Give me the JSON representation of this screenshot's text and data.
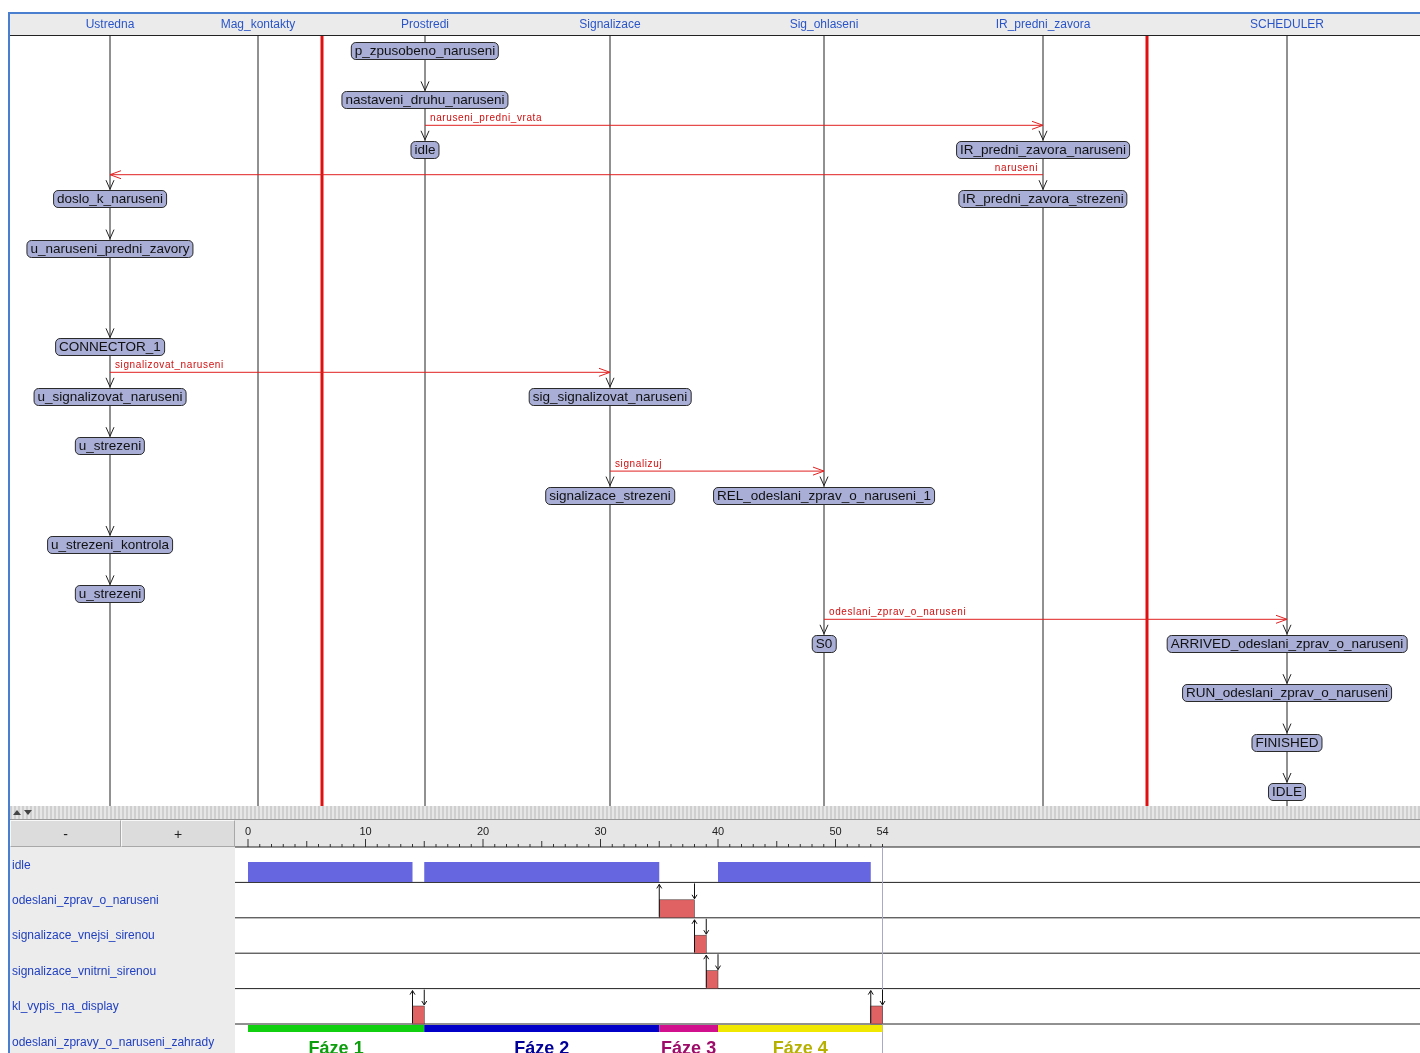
{
  "lanes": [
    {
      "name": "Ustredna",
      "boundary_before": false
    },
    {
      "name": "Mag_kontakty",
      "boundary_before": false
    },
    {
      "name": "Prostredi",
      "boundary_before": true
    },
    {
      "name": "Signalizace",
      "boundary_before": false
    },
    {
      "name": "Sig_ohlaseni",
      "boundary_before": false
    },
    {
      "name": "IR_predni_zavora",
      "boundary_before": false
    },
    {
      "name": "SCHEDULER",
      "boundary_before": true
    }
  ],
  "rows": [
    {
      "cells": [
        null,
        null,
        {
          "label": "p_zpusobeno_naruseni"
        },
        null,
        null,
        null,
        null
      ]
    },
    {
      "cells": [
        null,
        null,
        {
          "label": "nastaveni_druhu_naruseni"
        },
        null,
        null,
        null,
        null
      ]
    },
    {
      "cells": [
        null,
        null,
        {
          "label": "idle",
          "message_source": true
        },
        null,
        null,
        {
          "label": "IR_predni_zavora_naruseni",
          "message_target": true
        },
        null
      ],
      "message": {
        "label": "naruseni_predni_vrata"
      }
    },
    {
      "cells": [
        {
          "label": "doslo_k_naruseni",
          "message_target": true
        },
        null,
        null,
        null,
        null,
        {
          "label": "IR_predni_zavora_strezeni",
          "message_source": true
        },
        null
      ],
      "message": {
        "label": "naruseni"
      }
    },
    {
      "cells": [
        {
          "label": "u_naruseni_predni_zavory"
        },
        null,
        null,
        null,
        null,
        null,
        null
      ]
    },
    {
      "cells": [
        null,
        null,
        null,
        null,
        null,
        null,
        null
      ]
    },
    {
      "cells": [
        {
          "label": "CONNECTOR_1"
        },
        null,
        null,
        null,
        null,
        null,
        null
      ]
    },
    {
      "cells": [
        {
          "label": "u_signalizovat_naruseni",
          "message_source": true
        },
        null,
        null,
        {
          "label": "sig_signalizovat_naruseni",
          "message_target": true
        },
        null,
        null,
        null
      ],
      "message": {
        "label": "signalizovat_naruseni"
      }
    },
    {
      "cells": [
        {
          "label": "u_strezeni"
        },
        null,
        null,
        null,
        null,
        null,
        null
      ]
    },
    {
      "cells": [
        null,
        null,
        null,
        {
          "label": "signalizace_strezeni",
          "message_source": true
        },
        {
          "label": "REL_odeslani_zprav_o_naruseni_1",
          "message_target": true
        },
        null,
        null
      ],
      "message": {
        "label": "signalizuj"
      }
    },
    {
      "cells": [
        {
          "label": "u_strezeni_kontrola"
        },
        null,
        null,
        null,
        null,
        null,
        null
      ]
    },
    {
      "cells": [
        {
          "label": "u_strezeni"
        },
        null,
        null,
        null,
        null,
        null,
        null
      ]
    },
    {
      "cells": [
        null,
        null,
        null,
        null,
        {
          "label": "S0",
          "message_source": true
        },
        null,
        {
          "label": "ARRIVED_odeslani_zprav_o_naruseni",
          "message_target": true
        }
      ],
      "message": {
        "label": "odeslani_zprav_o_naruseni"
      }
    },
    {
      "cells": [
        null,
        null,
        null,
        null,
        null,
        null,
        {
          "label": "RUN_odeslani_zprav_o_naruseni"
        }
      ]
    },
    {
      "cells": [
        null,
        null,
        null,
        null,
        null,
        null,
        {
          "label": "FINISHED"
        }
      ]
    },
    {
      "cells": [
        null,
        null,
        null,
        null,
        null,
        null,
        {
          "label": "IDLE"
        }
      ]
    }
  ],
  "zoom_buttons": [
    "-",
    "+"
  ],
  "timeline": {
    "ticks": [
      "0",
      "10",
      "20",
      "30",
      "40",
      "50",
      "54"
    ],
    "signals": [
      {
        "label": "idle",
        "kind": "state",
        "color": "#6666e0"
      },
      {
        "label": "odeslani_zprav_o_naruseni",
        "kind": "pulse",
        "color": "#e06262"
      },
      {
        "label": "signalizace_vnejsi_sirenou",
        "kind": "pulse",
        "color": "#e06262"
      },
      {
        "label": "signalizace_vnitrni_sirenou",
        "kind": "pulse",
        "color": "#e06262"
      },
      {
        "label": "kl_vypis_na_display",
        "kind": "pulse",
        "color": "#e06262"
      },
      {
        "label": "odeslani_zpravy_o_naruseni_zahrady",
        "kind": "phases"
      }
    ],
    "phases": [
      {
        "label": "Fáze 1",
        "color": "#10d010"
      },
      {
        "label": "Fáze 2",
        "color": "#0000c8"
      },
      {
        "label": "Fáze 3",
        "color": "#d0108c"
      },
      {
        "label": "Fáze 4",
        "color": "#f0e800"
      }
    ]
  }
}
